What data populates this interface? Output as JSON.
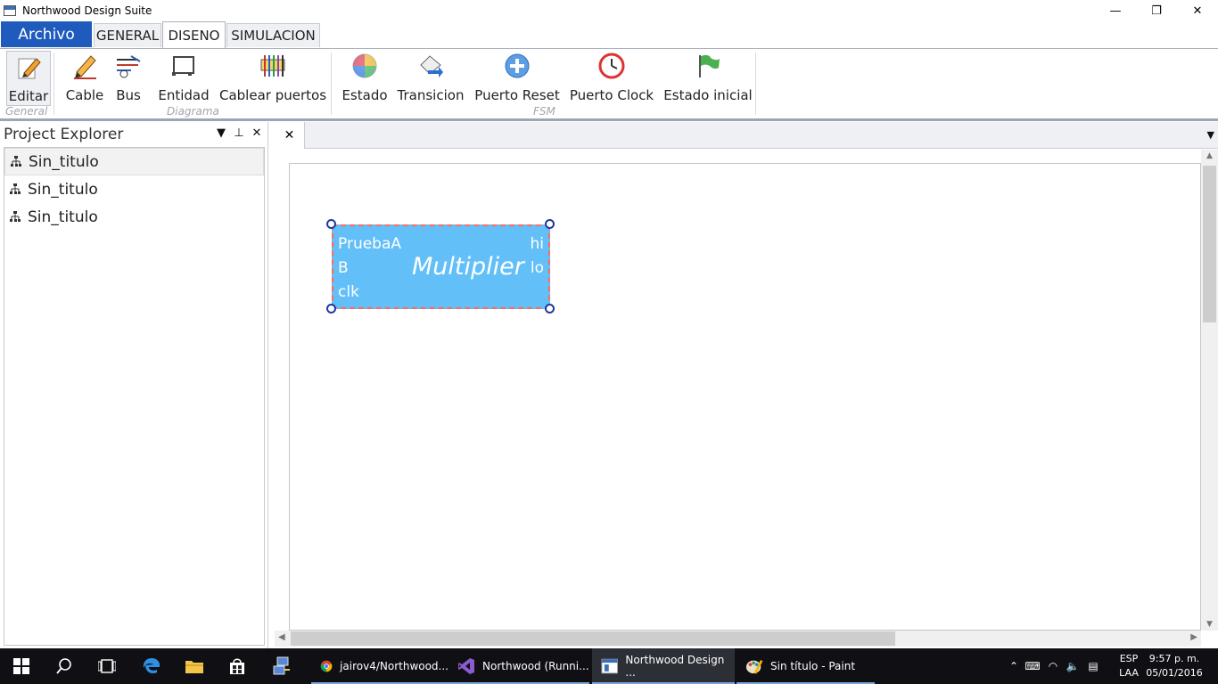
{
  "window": {
    "title": "Northwood Design Suite",
    "minimize": "—",
    "restore": "❐",
    "close": "✕"
  },
  "ribbon_tabs": {
    "file": "Archivo",
    "tabs": [
      "GENERAL",
      "DISENO",
      "SIMULACION"
    ],
    "active": "DISENO"
  },
  "ribbon": {
    "buttons": [
      "Editar",
      "Cable",
      "Bus",
      "Entidad",
      "Cablear puertos",
      "Estado",
      "Transicion",
      "Puerto Reset",
      "Puerto Clock",
      "Estado inicial"
    ],
    "groups": [
      "General",
      "Diagrama",
      "FSM"
    ]
  },
  "explorer": {
    "title": "Project Explorer",
    "items": [
      "Sin_titulo",
      "Sin_titulo",
      "Sin_titulo"
    ]
  },
  "document": {
    "close_tab": "✕"
  },
  "entity": {
    "name": "Multiplier",
    "inputs": [
      "PruebaA",
      "B",
      "clk"
    ],
    "outputs": [
      "hi",
      "lo"
    ],
    "fill": "#63bff8",
    "border": "#ff6b5b"
  },
  "taskbar": {
    "apps": [
      "jairov4/Northwood...",
      "Northwood (Runni...",
      "Northwood Design ...",
      "Sin título - Paint"
    ],
    "lang": [
      "ESP",
      "LAA"
    ],
    "time": "9:57 p. m.",
    "date": "05/01/2016"
  }
}
